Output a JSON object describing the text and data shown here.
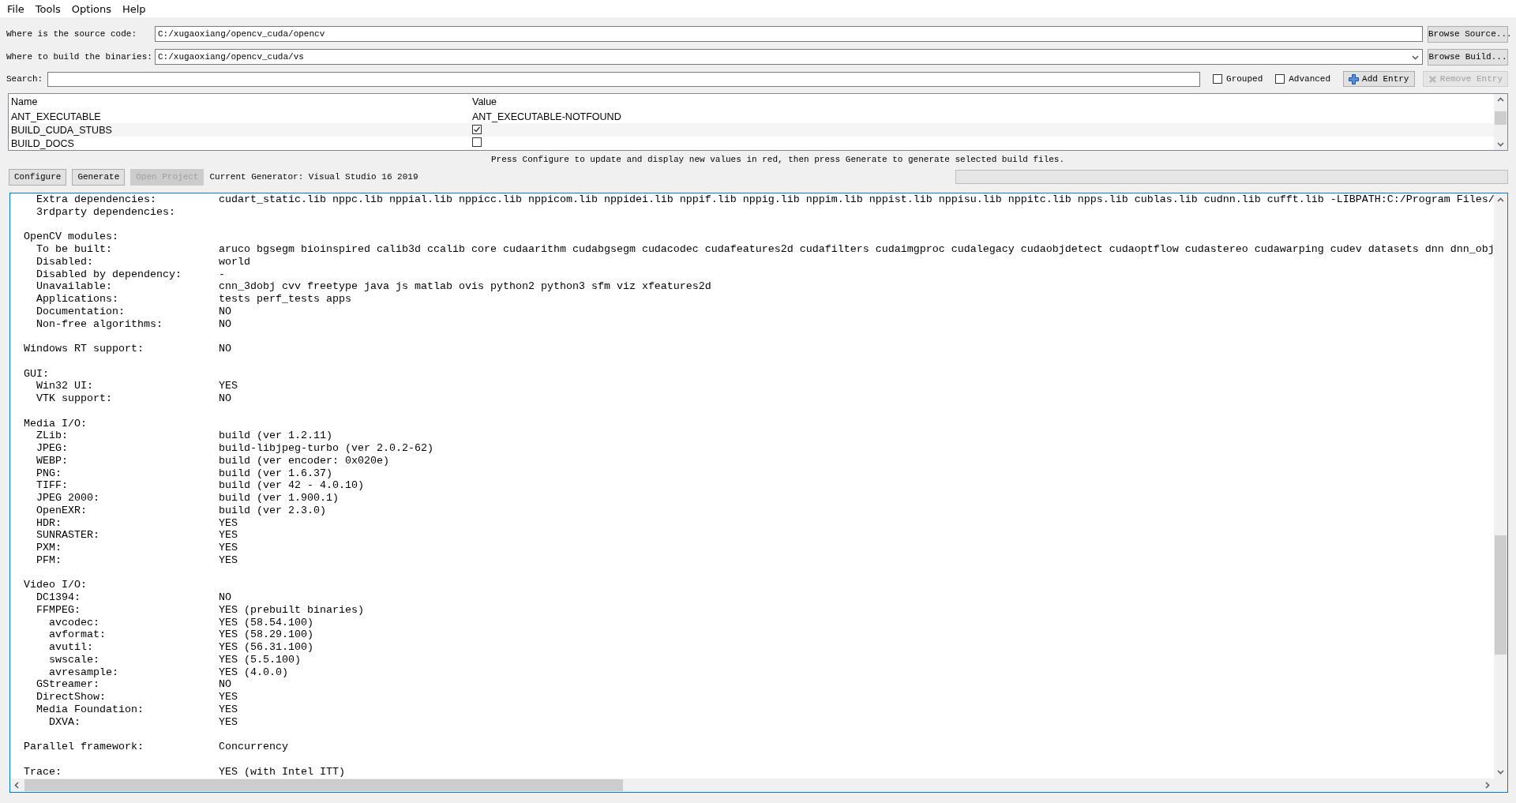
{
  "menu": [
    {
      "label": "File"
    },
    {
      "label": "Tools"
    },
    {
      "label": "Options"
    },
    {
      "label": "Help"
    }
  ],
  "source": {
    "label": "Where is the source code:",
    "value": "C:/xugaoxiang/opencv_cuda/opencv",
    "button": "Browse Source..."
  },
  "build": {
    "label": "Where to build the binaries:",
    "value": "C:/xugaoxiang/opencv_cuda/vs",
    "button": "Browse Build..."
  },
  "search": {
    "label": "Search:"
  },
  "options": [
    {
      "label": "Grouped",
      "checked": false
    },
    {
      "label": "Advanced",
      "checked": false
    }
  ],
  "entry_buttons": [
    {
      "kind": "add",
      "label": "Add Entry",
      "disabled": false
    },
    {
      "kind": "remove",
      "label": "Remove Entry",
      "disabled": true
    }
  ],
  "table": {
    "columns": [
      "Name",
      "Value"
    ],
    "rows": [
      {
        "name": "ANT_EXECUTABLE",
        "kind": "text",
        "value": "ANT_EXECUTABLE-NOTFOUND"
      },
      {
        "name": "BUILD_CUDA_STUBS",
        "kind": "bool",
        "checked": true
      },
      {
        "name": "BUILD_DOCS",
        "kind": "bool",
        "checked": false
      }
    ]
  },
  "message": "Press Configure to update and display new values in red, then press Generate to generate selected build files.",
  "actions": [
    {
      "label": "Configure",
      "disabled": false
    },
    {
      "label": "Generate",
      "disabled": false
    },
    {
      "label": "Open Project",
      "disabled": true
    }
  ],
  "generator": "Current Generator: Visual Studio 16 2019",
  "progress": {
    "level": 0
  },
  "log": {
    "groups": [
      {
        "items": [
          {
            "label": "Extra dependencies:",
            "value": "cudart_static.lib nppc.lib nppial.lib nppicc.lib nppicom.lib nppidei.lib nppif.lib nppig.lib nppim.lib nppist.lib nppisu.lib nppitc.lib npps.lib cublas.lib cudnn.lib cufft.lib -LIBPATH:C:/Program Files/"
          },
          {
            "label": "3rdparty dependencies:"
          }
        ]
      },
      {
        "heading": "OpenCV modules:",
        "items": [
          {
            "label": "To be built:",
            "value": "aruco bgsegm bioinspired calib3d ccalib core cudaarithm cudabgsegm cudacodec cudafeatures2d cudafilters cudaimgproc cudalegacy cudaobjdetect cudaoptflow cudastereo cudawarping cudev datasets dnn dnn_obj"
          },
          {
            "label": "Disabled:",
            "value": "world"
          },
          {
            "label": "Disabled by dependency:",
            "value": "-"
          },
          {
            "label": "Unavailable:",
            "value": "cnn_3dobj cvv freetype java js matlab ovis python2 python3 sfm viz xfeatures2d"
          },
          {
            "label": "Applications:",
            "value": "tests perf_tests apps"
          },
          {
            "label": "Documentation:",
            "value": "NO"
          },
          {
            "label": "Non-free algorithms:",
            "value": "NO"
          }
        ]
      },
      {
        "heading": "Windows RT support:",
        "value": "NO"
      },
      {
        "heading": "GUI:",
        "items": [
          {
            "label": "Win32 UI:",
            "value": "YES"
          },
          {
            "label": "VTK support:",
            "value": "NO"
          }
        ]
      },
      {
        "heading": "Media I/O:",
        "items": [
          {
            "label": "ZLib:",
            "value": "build (ver 1.2.11)"
          },
          {
            "label": "JPEG:",
            "value": "build-libjpeg-turbo (ver 2.0.2-62)"
          },
          {
            "label": "WEBP:",
            "value": "build (ver encoder: 0x020e)"
          },
          {
            "label": "PNG:",
            "value": "build (ver 1.6.37)"
          },
          {
            "label": "TIFF:",
            "value": "build (ver 42 - 4.0.10)"
          },
          {
            "label": "JPEG 2000:",
            "value": "build (ver 1.900.1)"
          },
          {
            "label": "OpenEXR:",
            "value": "build (ver 2.3.0)"
          },
          {
            "label": "HDR:",
            "value": "YES"
          },
          {
            "label": "SUNRASTER:",
            "value": "YES"
          },
          {
            "label": "PXM:",
            "value": "YES"
          },
          {
            "label": "PFM:",
            "value": "YES"
          }
        ]
      },
      {
        "heading": "Video I/O:",
        "items": [
          {
            "label": "DC1394:",
            "value": "NO"
          },
          {
            "label": "FFMPEG:",
            "value": "YES (prebuilt binaries)",
            "children": [
              {
                "label": "avcodec:",
                "value": "YES (58.54.100)"
              },
              {
                "label": "avformat:",
                "value": "YES (58.29.100)"
              },
              {
                "label": "avutil:",
                "value": "YES (56.31.100)"
              },
              {
                "label": "swscale:",
                "value": "YES (5.5.100)"
              },
              {
                "label": "avresample:",
                "value": "YES (4.0.0)"
              }
            ]
          },
          {
            "label": "GStreamer:",
            "value": "NO"
          },
          {
            "label": "DirectShow:",
            "value": "YES"
          },
          {
            "label": "Media Foundation:",
            "value": "YES",
            "children": [
              {
                "label": "DXVA:",
                "value": "YES"
              }
            ]
          }
        ]
      },
      {
        "heading": "Parallel framework:",
        "value": "Concurrency"
      },
      {
        "heading": "Trace:",
        "value": "YES (with Intel ITT)"
      }
    ]
  }
}
